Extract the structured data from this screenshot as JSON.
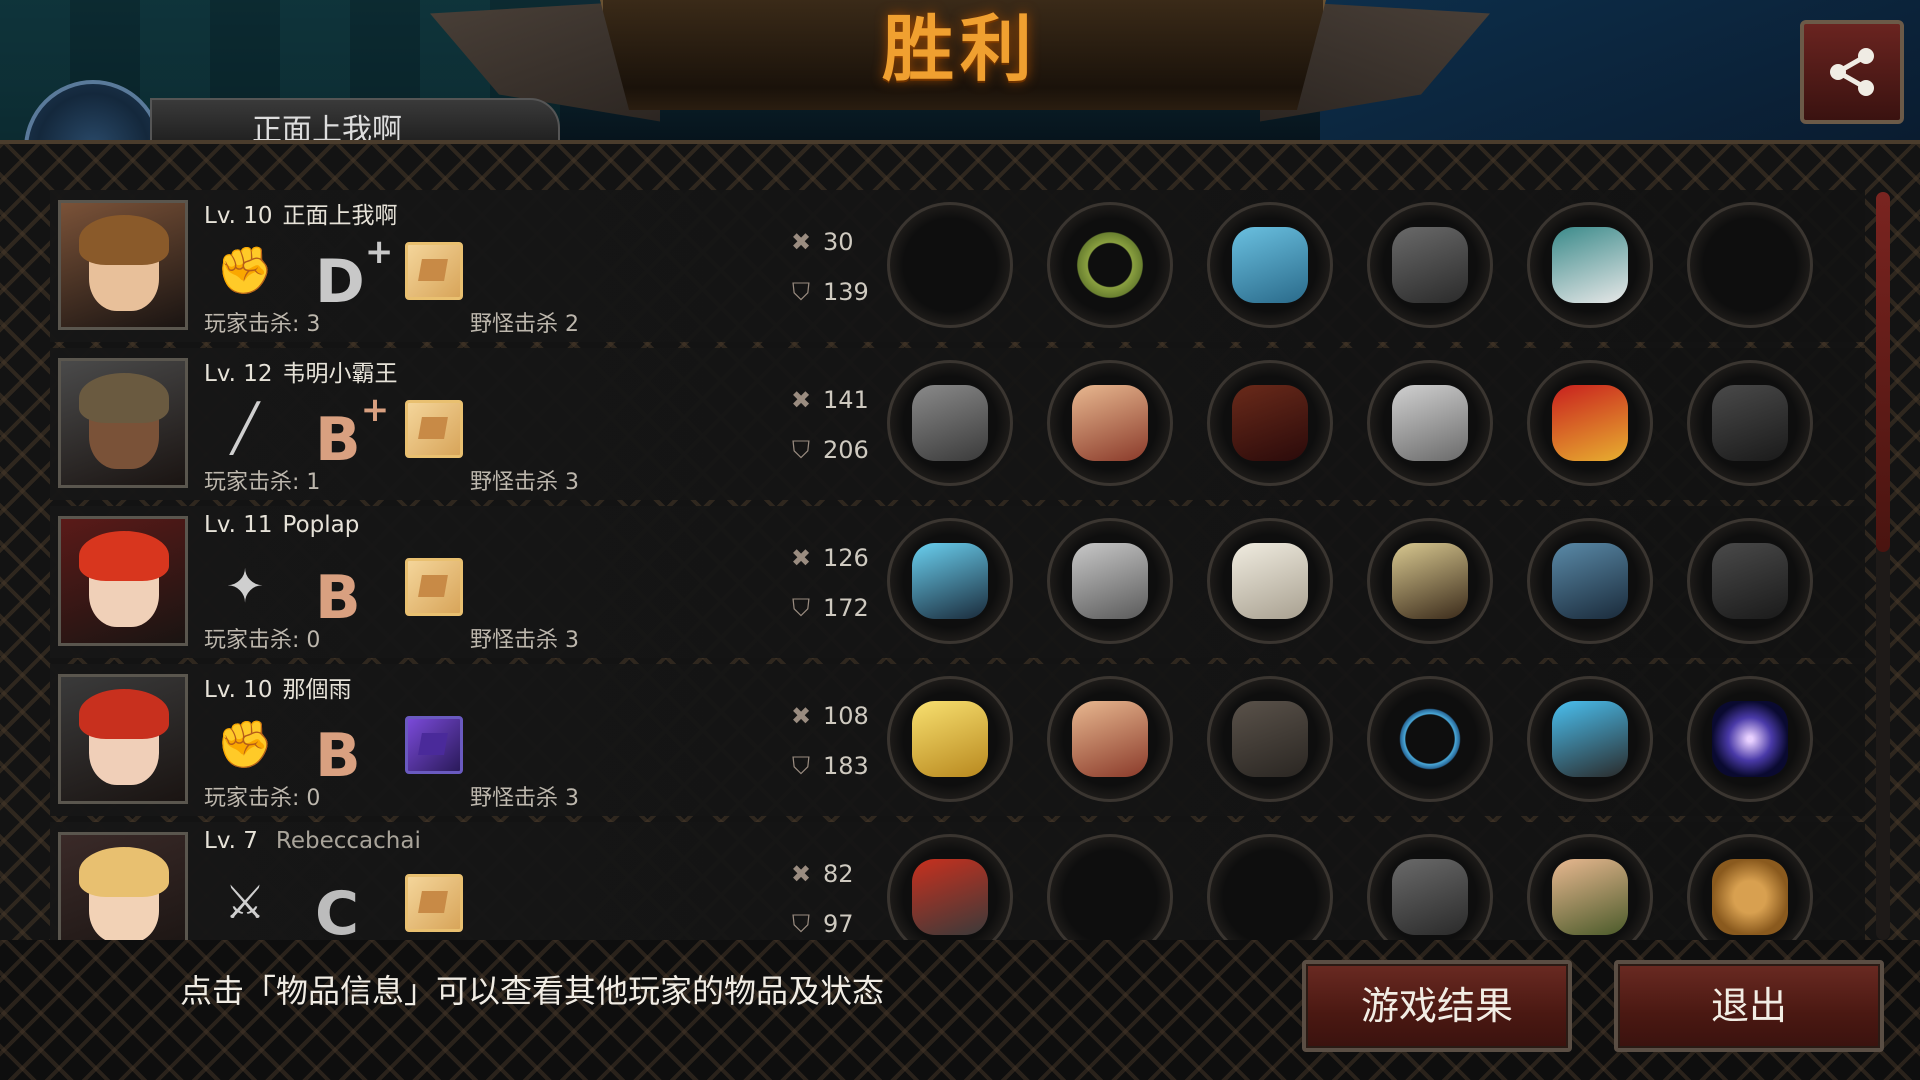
{
  "header": {
    "title": "胜利",
    "player_name_partial": "正面上我啊"
  },
  "players": [
    {
      "level": "Lv. 10",
      "name": "正面上我啊",
      "weapon_icon": "fist-icon",
      "grade": "D",
      "grade_plus": "+",
      "box_icon": "supply-box-icon",
      "player_kills": "玩家击杀: 3",
      "monster_kills": "野怪击杀 2",
      "attack": "30",
      "defense": "139",
      "items": [
        "empty",
        "laurel-wreath-icon",
        "blue-armor-icon",
        "shield-icon",
        "sneakers-icon",
        "empty"
      ]
    },
    {
      "level": "Lv. 12",
      "name": "韦明小霸王",
      "weapon_icon": "bat-icon",
      "grade": "B",
      "grade_plus": "+",
      "box_icon": "supply-box-icon",
      "player_kills": "玩家击杀: 1",
      "monster_kills": "野怪击杀 3",
      "attack": "141",
      "defense": "206",
      "items": [
        "statue-weapon-icon",
        "winged-tiara-icon",
        "leather-jacket-icon",
        "bracer-icon",
        "red-heels-icon",
        "binoculars-icon"
      ]
    },
    {
      "level": "Lv. 11",
      "name": "Poplap",
      "weapon_icon": "shuriken-icon",
      "grade": "B",
      "grade_plus": "",
      "box_icon": "supply-box-icon",
      "player_kills": "玩家击杀: 0",
      "monster_kills": "野怪击杀 3",
      "attack": "126",
      "defense": "172",
      "items": [
        "lightning-spear-icon",
        "knight-helmet-icon",
        "white-coat-icon",
        "wristwatch-icon",
        "steel-boots-icon",
        "binoculars-icon"
      ]
    },
    {
      "level": "Lv. 10",
      "name": "那個雨",
      "weapon_icon": "fist-icon",
      "grade": "B",
      "grade_plus": "",
      "box_icon": "purple-box-icon",
      "player_kills": "玩家击杀: 0",
      "monster_kills": "野怪击杀 3",
      "attack": "108",
      "defense": "183",
      "items": [
        "gold-gauntlet-icon",
        "winged-tiara-icon",
        "dark-jacket-icon",
        "bracelet-icon",
        "tech-shoes-icon",
        "galaxy-icon"
      ]
    },
    {
      "level": "Lv. 7",
      "name": "Rebeccachai",
      "weapon_icon": "rapier-icon",
      "grade": "C",
      "grade_plus": "",
      "box_icon": "supply-box-icon",
      "player_kills": "",
      "monster_kills": "",
      "attack": "82",
      "defense": "97",
      "items": [
        "halberd-icon",
        "empty",
        "empty",
        "shield-icon",
        "armored-boots-icon",
        "kettlebell-icon"
      ]
    }
  ],
  "footer": {
    "hint": "点击「物品信息」可以查看其他玩家的物品及状态",
    "result_button": "游戏结果",
    "exit_button": "退出"
  },
  "colors": {
    "title": "#f0a030",
    "button_bg": "#4a1812",
    "panel_bg": "#131313"
  }
}
